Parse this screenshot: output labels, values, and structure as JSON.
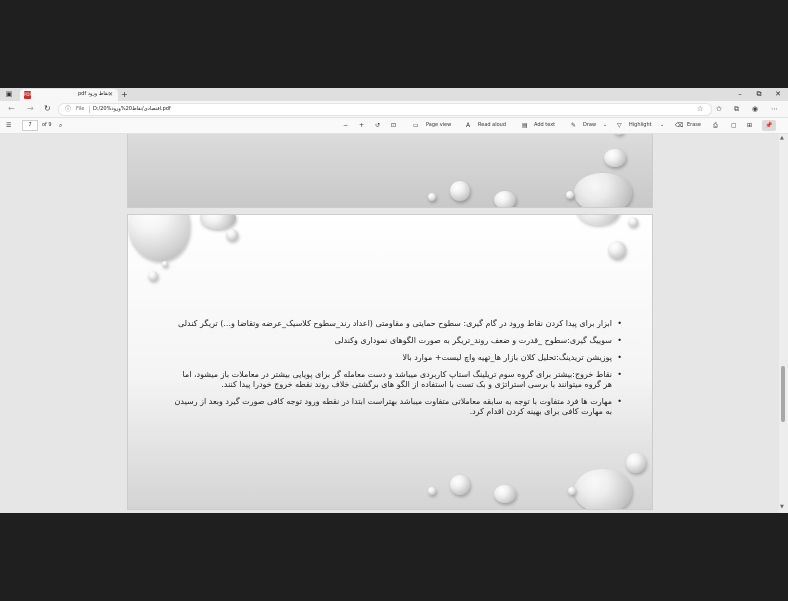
{
  "browser": {
    "tab_title": "نقاط ورود pdf",
    "tab_file_badge": "PDF",
    "file_label": "File",
    "url": "D:/20%اقتصادی/نقاط20%ورود.pdf"
  },
  "toolbar": {
    "page_current": "7",
    "page_total": "of 9",
    "page_view_label": "Page view",
    "read_aloud_label": "Read aloud",
    "add_text_label": "Add text",
    "draw_label": "Draw",
    "highlight_label": "Highlight",
    "erase_label": "Erase"
  },
  "slide": {
    "bullets": [
      "ابزار برای پیدا کردن نقاط ورود در گام گیری: سطوح حمایتی و مقاومتی (اعداد رند_سطوح کلاسیک_عرضه وتقاضا و...) تریگر کندلی",
      "سوییگ گیری:سطوح _قدرت و ضعف روند_تریگر به صورت الگوهای نموداری وکندلی",
      "پوزیشن تریدینگ:تحلیل کلان بازار ها_تهیه واچ لیست+ موارد بالا",
      "نقاط خروج:بیشتر برای گروه سوم تریلینگ استاپ کاربردی میباشد و دست معامله گر برای پویایی بیشتر در معاملات باز میشود، اما هر گروه میتوانند با برسی استراتژی و بک تست با استفاده از الگو های برگشتی خلاف روند نقطه خروج خودرا پیدا کنند.",
      "مهارت ها فرد متفاوت با توجه به سابقه معاملاتی متفاوت میباشد بهتراست ابتدا در نقطه ورود توجه کافی صورت گیرد وبعد از رسیدن به مهارت کافی برای بهینه کردن اقدام کرد."
    ]
  },
  "icons": [
    "menu-icon",
    "pdf-file-icon",
    "close-icon",
    "new-tab-icon",
    "minimize-icon",
    "maximize-icon",
    "back-icon",
    "forward-icon",
    "refresh-icon",
    "info-icon",
    "favorites-icon",
    "profile-icon",
    "more-icon",
    "search-icon",
    "zoom-out-icon",
    "zoom-in-icon",
    "rotate-icon",
    "fit-icon",
    "read-aloud-icon",
    "draw-icon",
    "highlight-icon",
    "erase-icon",
    "print-icon",
    "save-icon",
    "pin-icon"
  ]
}
